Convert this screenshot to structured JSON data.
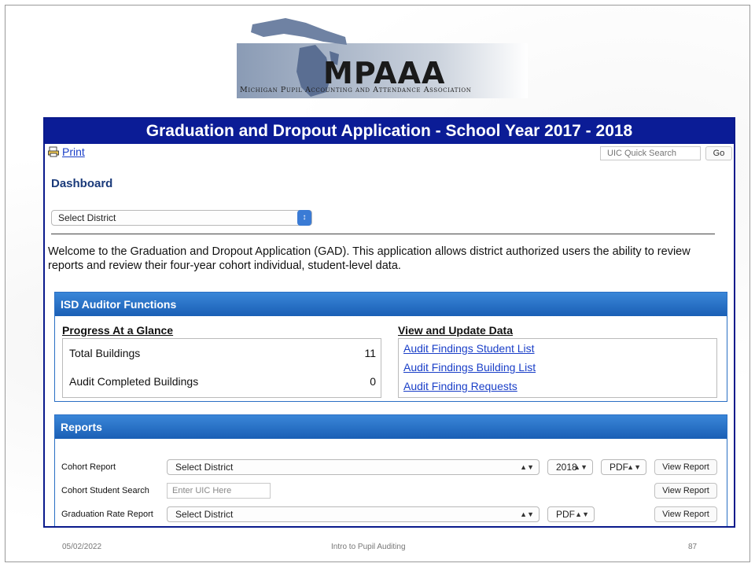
{
  "logo": {
    "acronym": "MPAAA",
    "full_name": "Michigan Pupil Accounting and Attendance Association"
  },
  "app": {
    "title": "Graduation and Dropout Application - School Year 2017 - 2018",
    "print_label": "Print",
    "uic_search_placeholder": "UIC Quick Search",
    "go_label": "Go",
    "dashboard_label": "Dashboard",
    "district_select": "Select District",
    "welcome_text": "Welcome to the Graduation and Dropout Application (GAD). This application allows district authorized users the ability to review reports and review their four-year cohort individual, student-level data."
  },
  "isd": {
    "title": "ISD Auditor Functions",
    "glance_title": "Progress At a Glance",
    "rows": [
      {
        "label": "Total Buildings",
        "value": "11"
      },
      {
        "label": "Audit Completed Buildings",
        "value": "0"
      }
    ],
    "view_title": "View and Update Data",
    "links": [
      "Audit Findings Student List",
      "Audit Findings Building List",
      "Audit Finding Requests"
    ]
  },
  "reports": {
    "title": "Reports",
    "rows": [
      {
        "label": "Cohort Report",
        "district": "Select District",
        "year": "2018",
        "format": "PDF",
        "button": "View Report"
      },
      {
        "label": "Cohort Student Search",
        "uic_placeholder": "Enter UIC Here",
        "button": "View Report"
      },
      {
        "label": "Graduation Rate Report",
        "district": "Select District",
        "format": "PDF",
        "button": "View Report"
      }
    ]
  },
  "footer": {
    "date": "05/02/2022",
    "title": "Intro to Pupil Auditing",
    "page": "87"
  },
  "colors": {
    "header_navy": "#0b1c96",
    "panel_blue": "#2a6fc4",
    "link_blue": "#1a3fc8"
  }
}
